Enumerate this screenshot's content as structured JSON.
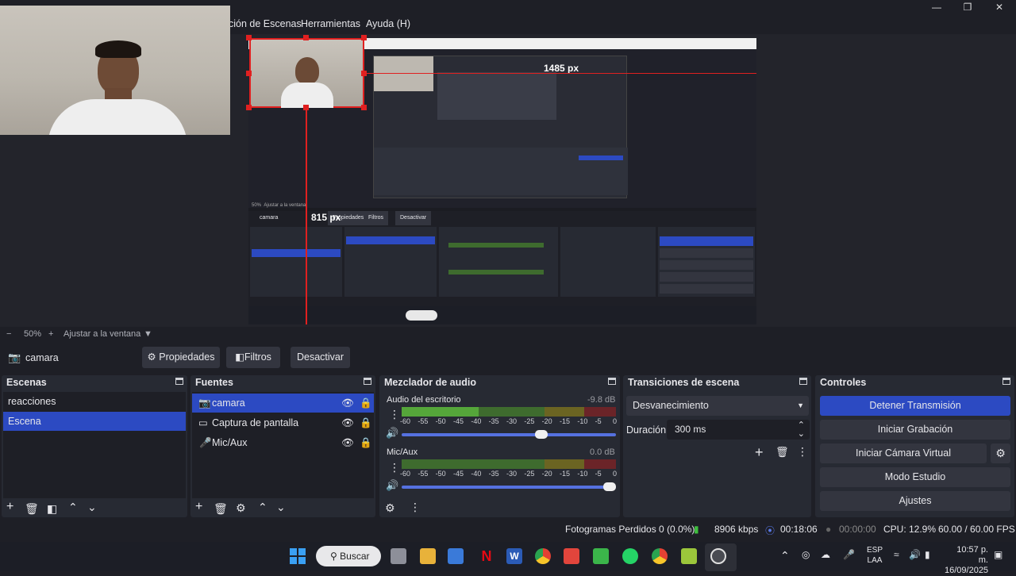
{
  "window": {
    "title": ""
  },
  "menu": {
    "items": [
      "ción de Escenas",
      "Herramientas",
      "Ayuda (H)"
    ]
  },
  "preview": {
    "measure_h": "1485 px",
    "measure_v": "815 px",
    "nested_source": "camara",
    "nested_btns": [
      "Propiedades",
      "Filtros",
      "Desactivar"
    ],
    "nested_zoom": "50%",
    "nested_zoom_label": "Ajustar a la ventana"
  },
  "zoom": {
    "minus": "−",
    "value": "50%",
    "plus": "+",
    "label": "Ajustar a la ventana"
  },
  "sourcebar": {
    "name": "camara",
    "properties": "Propiedades",
    "filters": "Filtros",
    "deactivate": "Desactivar"
  },
  "scenes": {
    "title": "Escenas",
    "items": [
      "reacciones",
      "Escena"
    ],
    "selected": 1
  },
  "sources": {
    "title": "Fuentes",
    "items": [
      {
        "label": "camara",
        "icon": "camera-icon"
      },
      {
        "label": "Captura de pantalla",
        "icon": "monitor-icon"
      },
      {
        "label": "Mic/Aux",
        "icon": "microphone-icon"
      }
    ],
    "selected": 0
  },
  "mixer": {
    "title": "Mezclador de audio",
    "channels": [
      {
        "name": "Audio del escritorio",
        "db": "-9.8 dB",
        "level": 0.36,
        "volume": 0.68
      },
      {
        "name": "Mic/Aux",
        "db": "0.0 dB",
        "level": 0,
        "volume": 1.0
      }
    ],
    "scale": [
      "-60",
      "-55",
      "-50",
      "-45",
      "-40",
      "-35",
      "-30",
      "-25",
      "-20",
      "-15",
      "-10",
      "-5",
      "0"
    ]
  },
  "transitions": {
    "title": "Transiciones de escena",
    "selected": "Desvanecimiento",
    "duration_label": "Duración",
    "duration_value": "300 ms"
  },
  "controls": {
    "title": "Controles",
    "buttons": [
      "Detener Transmisión",
      "Iniciar Grabación",
      "Iniciar Cámara Virtual",
      "Modo Estudio",
      "Ajustes"
    ]
  },
  "status": {
    "dropped": "Fotogramas Perdidos 0 (0.0%)",
    "bitrate": "8906 kbps",
    "stream_time": "00:18:06",
    "rec_time": "00:00:00",
    "cpu": "CPU: 12.9%",
    "fps": "60.00 / 60.00 FPS"
  },
  "taskbar": {
    "search": "Buscar",
    "lang1": "ESP",
    "lang2": "LAA",
    "time": "10:57 p. m.",
    "date": "16/09/2025"
  },
  "colors": {
    "accent": "#2c4ac2",
    "bg": "#1e1f26",
    "dock": "#272a33",
    "red": "#e02020"
  }
}
